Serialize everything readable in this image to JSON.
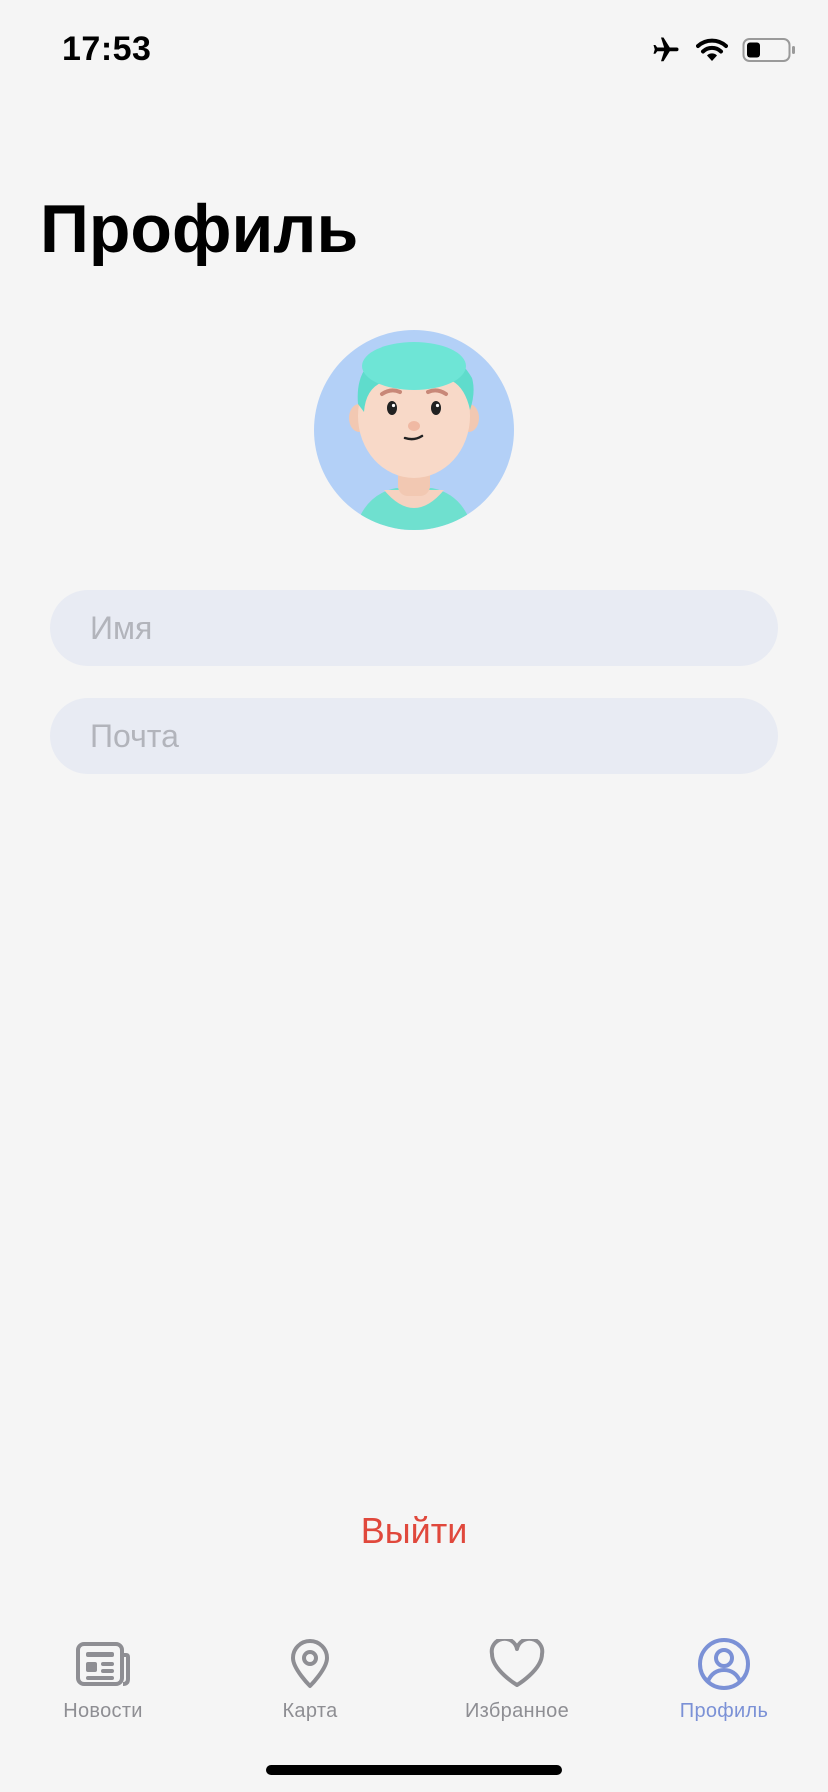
{
  "status_bar": {
    "time": "17:53"
  },
  "page": {
    "title": "Профиль"
  },
  "form": {
    "name_placeholder": "Имя",
    "email_placeholder": "Почта"
  },
  "actions": {
    "logout_label": "Выйти"
  },
  "tab_bar": {
    "items": [
      {
        "label": "Новости",
        "icon": "newspaper-icon",
        "active": false
      },
      {
        "label": "Карта",
        "icon": "map-pin-icon",
        "active": false
      },
      {
        "label": "Избранное",
        "icon": "heart-icon",
        "active": false
      },
      {
        "label": "Профиль",
        "icon": "person-circle-icon",
        "active": true
      }
    ]
  },
  "colors": {
    "background": "#f5f5f5",
    "field_background": "#e8ebf3",
    "logout": "#e0483c",
    "tab_active": "#7b91d6",
    "tab_inactive": "#8e8e93",
    "avatar_background": "#b3d0f7"
  }
}
